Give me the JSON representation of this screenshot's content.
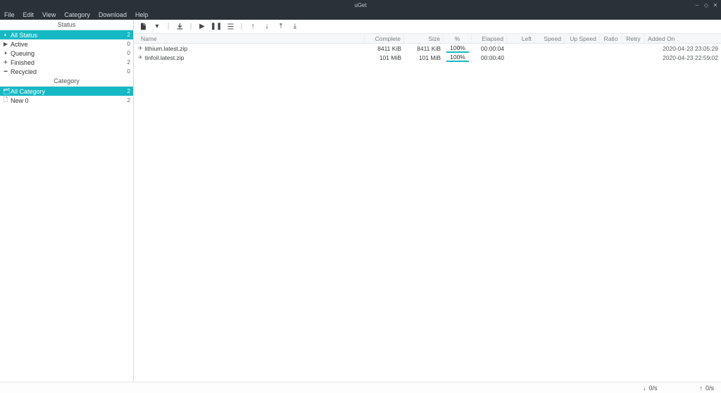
{
  "title": "uGet",
  "menu": [
    "File",
    "Edit",
    "View",
    "Category",
    "Download",
    "Help"
  ],
  "sidebar": {
    "status_header": "Status",
    "category_header": "Category",
    "status": [
      {
        "icon": "◐",
        "label": "All Status",
        "count": "2",
        "selected": true
      },
      {
        "icon": "▶",
        "label": "Active",
        "count": "0"
      },
      {
        "icon": "⏸",
        "label": "Queuing",
        "count": "0"
      },
      {
        "icon": "✈",
        "label": "Finished",
        "count": "2"
      },
      {
        "icon": "━",
        "label": "Recycled",
        "count": "0"
      }
    ],
    "category": [
      {
        "icon": "🗂",
        "label": "All Category",
        "count": "2",
        "selected": true
      },
      {
        "icon": "🗋",
        "label": "New 0",
        "count": "2"
      }
    ]
  },
  "columns": {
    "name": "Name",
    "complete": "Complete",
    "size": "Size",
    "pct": "%",
    "elapsed": "Elapsed",
    "left": "Left",
    "speed": "Speed",
    "upspeed": "Up Speed",
    "ratio": "Ratio",
    "retry": "Retry",
    "added": "Added On"
  },
  "rows": [
    {
      "name": "lithium.latest.zip",
      "complete": "8411 KiB",
      "size": "8411 KiB",
      "pct": "100%",
      "elapsed": "00:00:04",
      "added": "2020-04-23 23:05:29"
    },
    {
      "name": "tinfoil.latest.zip",
      "complete": "101 MiB",
      "size": "101 MiB",
      "pct": "100%",
      "elapsed": "00:00:40",
      "added": "2020-04-23 22:59:02"
    }
  ],
  "statusbar": {
    "down": "0/s",
    "up": "0/s"
  }
}
